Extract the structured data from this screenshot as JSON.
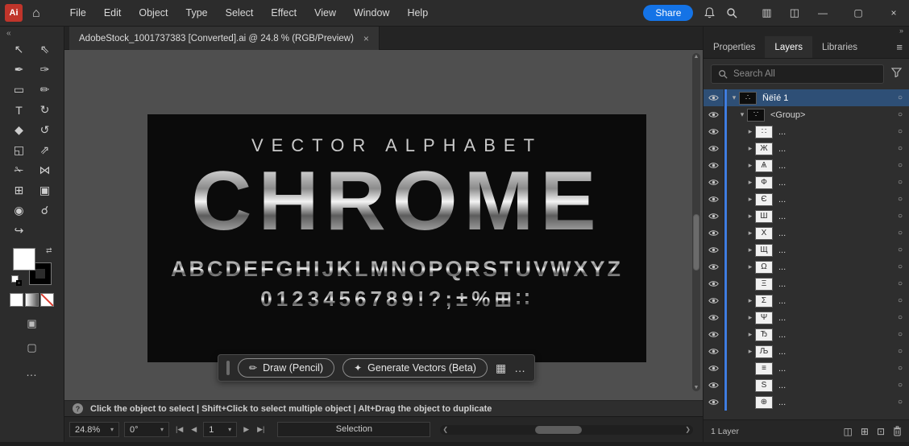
{
  "colors": {
    "accent_blue": "#1473e6",
    "selection_blue": "#2e4f76",
    "layer_color_blue": "#3f7de0",
    "artboard_black": "#0b0b0b",
    "canvas_gray": "#4f4f4f"
  },
  "titlebar": {
    "menus": [
      "File",
      "Edit",
      "Object",
      "Type",
      "Select",
      "Effect",
      "View",
      "Window",
      "Help"
    ],
    "share_label": "Share"
  },
  "icons": {
    "app_logo": "Ai",
    "home": "⌂",
    "minimize": "—",
    "maximize": "▢",
    "close": "×",
    "workspace_a": "▥",
    "workspace_b": "◫",
    "collapse_left": "«",
    "collapse_right": "»",
    "hamburger": "≡",
    "chevron_down": "▾",
    "chevron_right": "▸",
    "target": "○",
    "caret_down": "▾",
    "nav_first": "|◀",
    "nav_prev": "◀",
    "nav_next": "▶",
    "nav_last": "▶|",
    "scroll_up": "▲",
    "scroll_down": "▼",
    "scroll_left": "❮",
    "scroll_right": "❯",
    "pencil": "✏",
    "sparkle": "✦",
    "media": "▦",
    "ellipsis": "…",
    "help": "?",
    "swap": "⇄",
    "draw_mode": "▣",
    "screen_mode": "▢",
    "cursor": "▲"
  },
  "toolbar": {
    "tools": [
      {
        "name": "selection-tool-icon",
        "glyph": "↖"
      },
      {
        "name": "direct-selection-tool-icon",
        "glyph": "⇖"
      },
      {
        "name": "pen-tool-icon",
        "glyph": "✒"
      },
      {
        "name": "curvature-tool-icon",
        "glyph": "✑"
      },
      {
        "name": "rectangle-tool-icon",
        "glyph": "▭"
      },
      {
        "name": "paintbrush-tool-icon",
        "glyph": "✏"
      },
      {
        "name": "type-tool-icon",
        "glyph": "T"
      },
      {
        "name": "rotate-tool-icon",
        "glyph": "↻"
      },
      {
        "name": "eraser-tool-icon",
        "glyph": "◆"
      },
      {
        "name": "rotate-view-tool-icon",
        "glyph": "↺"
      },
      {
        "name": "scale-tool-icon",
        "glyph": "◱"
      },
      {
        "name": "shear-tool-icon",
        "glyph": "⇗"
      },
      {
        "name": "knife-tool-icon",
        "glyph": "✁"
      },
      {
        "name": "width-tool-icon",
        "glyph": "⋈"
      },
      {
        "name": "perspective-grid-tool-icon",
        "glyph": "⊞"
      },
      {
        "name": "artboard-tool-icon",
        "glyph": "▣"
      },
      {
        "name": "shape-builder-tool-icon",
        "glyph": "◉"
      },
      {
        "name": "zoom-tool-icon",
        "glyph": "☌"
      },
      {
        "name": "hand-tool-icon",
        "glyph": "↪"
      }
    ]
  },
  "doc_tab": {
    "title": "AdobeStock_1001737383 [Converted].ai @ 24.8 % (RGB/Preview)"
  },
  "artboard": {
    "subtitle": "VECTOR ALPHABET",
    "title": "CHROME",
    "row_alphabet": "ABCDEFGHIJKLMNOPQRSTUVWXYZ",
    "row_symbols": "0123456789!?;±%⊞∷"
  },
  "context_toolbar": {
    "draw_label": "Draw (Pencil)",
    "generate_label": "Generate Vectors (Beta)"
  },
  "statusbar": {
    "hint": "Click the object to select  |  Shift+Click to select multiple object  |  Alt+Drag the object to duplicate"
  },
  "bottom_bar": {
    "zoom": "24.8%",
    "rotation": "0°",
    "artboard_num": "1",
    "tool_status": "Selection"
  },
  "panel": {
    "tabs": [
      {
        "label": "Properties",
        "active": false
      },
      {
        "label": "Layers",
        "active": true
      },
      {
        "label": "Libraries",
        "active": false
      }
    ],
    "search_placeholder": "Search All"
  },
  "layers_panel": {
    "footer_count": "1 Layer",
    "footer_icons": [
      {
        "name": "make-clipping-mask-icon",
        "glyph": "◫"
      },
      {
        "name": "new-sublayer-icon",
        "glyph": "⊞"
      },
      {
        "name": "new-layer-icon",
        "glyph": "⊡"
      }
    ],
    "rows": [
      {
        "name": "Ñëîé 1",
        "level": 0,
        "chevron": "down",
        "thumb": "∴",
        "dark": true,
        "selected": true
      },
      {
        "name": "<Group>",
        "level": 1,
        "chevron": "down",
        "thumb": "∵",
        "dark": true,
        "selected": false
      },
      {
        "name": "...",
        "level": 2,
        "chevron": "right",
        "thumb": "∷",
        "dark": false,
        "selected": false
      },
      {
        "name": "...",
        "level": 2,
        "chevron": "right",
        "thumb": "Ж",
        "dark": false,
        "selected": false
      },
      {
        "name": "...",
        "level": 2,
        "chevron": "right",
        "thumb": "Ѧ",
        "dark": false,
        "selected": false
      },
      {
        "name": "...",
        "level": 2,
        "chevron": "right",
        "thumb": "Ф",
        "dark": false,
        "selected": false
      },
      {
        "name": "...",
        "level": 2,
        "chevron": "right",
        "thumb": "Є",
        "dark": false,
        "selected": false
      },
      {
        "name": "...",
        "level": 2,
        "chevron": "right",
        "thumb": "Ш",
        "dark": false,
        "selected": false
      },
      {
        "name": "...",
        "level": 2,
        "chevron": "right",
        "thumb": "Х",
        "dark": false,
        "selected": false
      },
      {
        "name": "...",
        "level": 2,
        "chevron": "right",
        "thumb": "Щ",
        "dark": false,
        "selected": false
      },
      {
        "name": "...",
        "level": 2,
        "chevron": "right",
        "thumb": "Ω",
        "dark": false,
        "selected": false
      },
      {
        "name": "...",
        "level": 2,
        "chevron": "",
        "thumb": "Ξ",
        "dark": false,
        "selected": false
      },
      {
        "name": "...",
        "level": 2,
        "chevron": "right",
        "thumb": "Σ",
        "dark": false,
        "selected": false
      },
      {
        "name": "...",
        "level": 2,
        "chevron": "right",
        "thumb": "Ψ",
        "dark": false,
        "selected": false
      },
      {
        "name": "...",
        "level": 2,
        "chevron": "right",
        "thumb": "Ђ",
        "dark": false,
        "selected": false
      },
      {
        "name": "...",
        "level": 2,
        "chevron": "right",
        "thumb": "Љ",
        "dark": false,
        "selected": false
      },
      {
        "name": "...",
        "level": 2,
        "chevron": "",
        "thumb": "≡",
        "dark": false,
        "selected": false
      },
      {
        "name": "...",
        "level": 2,
        "chevron": "",
        "thumb": "Ѕ",
        "dark": false,
        "selected": false
      },
      {
        "name": "...",
        "level": 2,
        "chevron": "",
        "thumb": "⊕",
        "dark": false,
        "selected": false
      }
    ]
  }
}
